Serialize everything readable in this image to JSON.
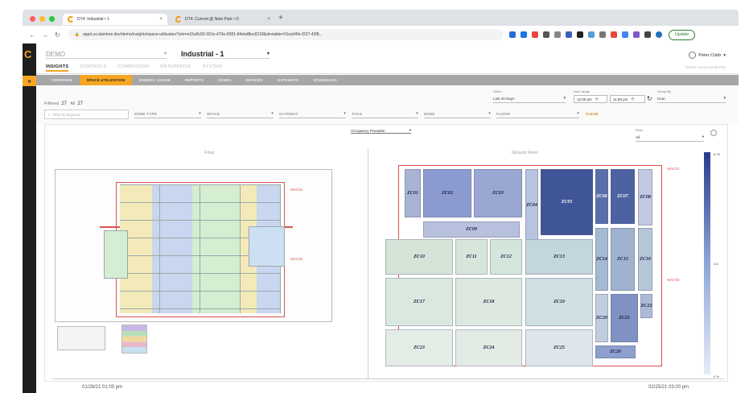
{
  "browser": {
    "tabs": [
      {
        "label": "DT4: Industrial • 1",
        "active": true
      },
      {
        "label": "DT4: Current @ Nets Park • D",
        "active": false
      }
    ],
    "url": "appd.us.daintree.dev/demo/insights/space-utilization?site=e15e8c69-391e-470e-9081-84ebd8ec8218&devtable=01ea04fe-f237-43f8...",
    "update_label": "Update"
  },
  "app": {
    "logo": "C",
    "org": "DEMO",
    "site": "Industrial - 1",
    "user": "Peter Cobb",
    "timezone": "Rafael Victoria (5:29 PM)",
    "main_nav": [
      "INSIGHTS",
      "CONTROLS",
      "COMMISSION",
      "ENTERPRISE",
      "SYSTEM"
    ],
    "sub_nav": [
      "OVERVIEW",
      "SPACE UTILIZATION",
      "ENERGY USAGE",
      "REPORTS",
      "ZONES",
      "DEVICES",
      "GATEWAYS",
      "SCHEDULES"
    ],
    "active_sub_nav": "SPACE UTILIZATION"
  },
  "filters": {
    "filtered_label": "Filtered",
    "filtered_count": "27",
    "all_label": "All",
    "all_count": "27",
    "search_placeholder": "Filter by keyword",
    "selects": [
      "ZONE TYPE",
      "SPACE",
      "GATEWAY",
      "TAGS",
      "ZONE",
      "FLOOR"
    ],
    "clear": "CLEAR",
    "when_label": "When",
    "when_value": "Last 30 Days",
    "hour_range_label": "Hour range",
    "hour_from": "12:00 am",
    "hour_to": "11:59 pm",
    "group_by_label": "Group By",
    "group_by_value": "Hour"
  },
  "panel": {
    "view": "Occupancy Floorplan",
    "floor_label": "Floor",
    "floor_value": "All",
    "plan_left_title": "Final",
    "plan_right_title": "Ground Floor",
    "wac_labels": [
      "WAC01",
      "WAC02"
    ],
    "zones": [
      "ZC01",
      "ZC02",
      "ZC03",
      "ZC04",
      "ZC05",
      "ZC06",
      "ZC07",
      "ZC08",
      "ZC09",
      "ZC10",
      "ZC11",
      "ZC12",
      "ZC13",
      "ZC14",
      "ZC15",
      "ZC16",
      "ZC17",
      "ZC18",
      "ZC19",
      "ZC20",
      "ZC21",
      "ZC22",
      "ZC23",
      "ZC24",
      "ZC25",
      "ZC26"
    ],
    "legend": {
      "top": "8.75",
      "mid": "4.5",
      "bottom": "0 %"
    }
  },
  "timeline": {
    "start": "01/28/21 01:00 pm",
    "end": "02/25/21 03:00 pm"
  }
}
